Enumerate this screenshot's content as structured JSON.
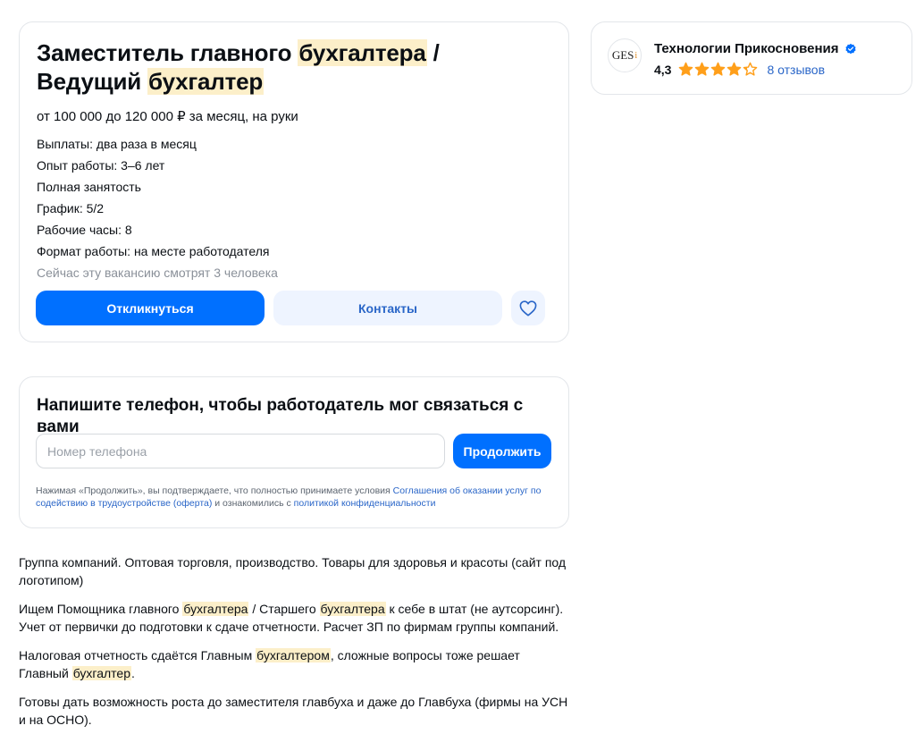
{
  "vacancy": {
    "title_part1": "Заместитель главного ",
    "title_hl1": "бухгалтера",
    "title_part2": " / Ведущий ",
    "title_hl2": "бухгалтер",
    "salary": "от 100 000 до 120 000 ₽ за месяц, на руки",
    "facts": [
      "Выплаты: два раза в месяц",
      "Опыт работы: 3–6 лет",
      "Полная занятость",
      "График: 5/2",
      "Рабочие часы: 8",
      "Формат работы: на месте работодателя"
    ],
    "watchers": "Сейчас эту вакансию смотрят 3 человека",
    "respond_label": "Откликнуться",
    "contacts_label": "Контакты",
    "favorite_icon": "heart-icon"
  },
  "phone_form": {
    "title": "Напишите телефон, чтобы работодатель мог связаться с вами",
    "input_placeholder": "Номер телефона",
    "input_value": "",
    "continue_label": "Продолжить",
    "agreement_prefix": "Нажимая «Продолжить», вы подтверждаете, что полностью принимаете условия ",
    "agreement_link1": "Соглашения об оказании услуг по содействию в трудоустройстве (оферта)",
    "agreement_middle": " и ознакомились с ",
    "agreement_link2": "политикой конфиденциальности"
  },
  "description": {
    "p1": "Группа компаний. Оптовая торговля, производство. Товары для здоровья и красоты (сайт под логотипом)",
    "p2_a": "Ищем Помощника главного ",
    "p2_hl1": "бухгалтера",
    "p2_b": " / Старшего ",
    "p2_hl2": "бухгалтера",
    "p2_c": " к себе в штат (не аутсорсинг). Учет от первички до подготовки к сдаче отчетности. Расчет ЗП по фирмам группы компаний.",
    "p3_a": "Налоговая отчетность сдаётся Главным ",
    "p3_hl1": "бухгалтером",
    "p3_b": ", сложные вопросы тоже решает Главный ",
    "p3_hl2": "бухгалтер",
    "p3_c": ".",
    "p4": "Готовы дать возможность роста до заместителя главбуха и даже до Главбуха (фирмы на УСН и на ОСНО)."
  },
  "company": {
    "logo_text": "GES",
    "logo_accent": "i",
    "name": "Технологии Прикосновения",
    "verified_icon": "verified-badge-icon",
    "rating": "4,3",
    "rating_numeric": 4.3,
    "stars_max": 5,
    "reviews_label": "8 отзывов"
  },
  "colors": {
    "primary": "#0070ff",
    "secondary_bg": "#eef4ff",
    "link": "#2a66c8",
    "highlight": "#fcefc9",
    "star": "#ff9f1a"
  }
}
